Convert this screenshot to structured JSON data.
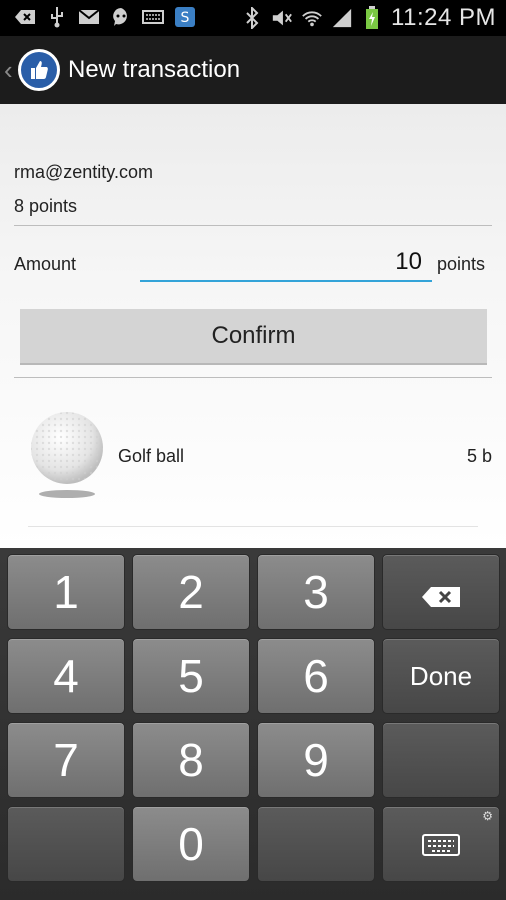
{
  "status_bar": {
    "time": "11:24 PM",
    "icons_left": [
      "add-icon",
      "usb-icon",
      "mail-icon",
      "talk-icon",
      "keyboard-icon",
      "skype-icon"
    ],
    "icons_right": [
      "bluetooth-icon",
      "mute-icon",
      "wifi-icon",
      "signal-icon",
      "battery-icon"
    ]
  },
  "action_bar": {
    "title": "New transaction"
  },
  "account": {
    "email": "rma@zentity.com",
    "points": "8 points"
  },
  "amount": {
    "label": "Amount",
    "value": "10",
    "unit": "points"
  },
  "confirm_label": "Confirm",
  "items": [
    {
      "name": "Golf ball",
      "cost": "5 b"
    }
  ],
  "keyboard": {
    "rows": [
      [
        "1",
        "2",
        "3",
        "backspace"
      ],
      [
        "4",
        "5",
        "6",
        "Done"
      ],
      [
        "7",
        "8",
        "9",
        ""
      ],
      [
        "",
        "0",
        "",
        "keyboard-settings"
      ]
    ],
    "done_label": "Done"
  }
}
